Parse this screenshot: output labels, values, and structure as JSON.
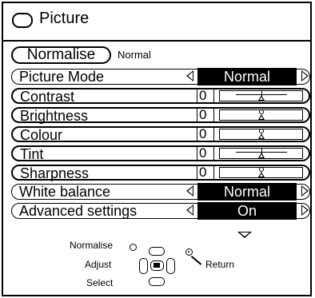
{
  "header": {
    "title": "Picture",
    "icon": "tv-screen-icon"
  },
  "normalise": {
    "button_label": "Normalise",
    "status": "Normal"
  },
  "rows": [
    {
      "label": "Picture Mode",
      "type": "select",
      "value": "Normal",
      "selected": true
    },
    {
      "label": "Contrast",
      "type": "slider",
      "value": "0",
      "level": 0.5
    },
    {
      "label": "Brightness",
      "type": "slider",
      "value": "0",
      "level": 0.5
    },
    {
      "label": "Colour",
      "type": "slider",
      "value": "0",
      "level": 0.5
    },
    {
      "label": "Tint",
      "type": "slider",
      "value": "0",
      "level": 0.5
    },
    {
      "label": "Sharpness",
      "type": "slider",
      "value": "0",
      "level": 0.5
    },
    {
      "label": "White balance",
      "type": "select",
      "value": "Normal",
      "selected": true
    },
    {
      "label": "Advanced settings",
      "type": "select",
      "value": "On",
      "selected": true
    }
  ],
  "legend": {
    "normalise": "Normalise",
    "adjust": "Adjust",
    "select": "Select",
    "return": "Return"
  }
}
